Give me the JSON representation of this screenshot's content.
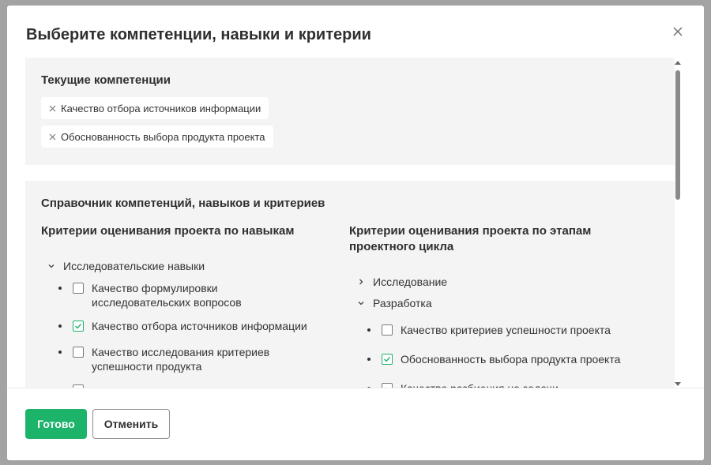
{
  "modal": {
    "title": "Выберите компетенции, навыки и критерии"
  },
  "current": {
    "heading": "Текущие компетенции",
    "chips": [
      "Качество отбора источников информации",
      "Обоснованность выбора продукта проекта"
    ]
  },
  "catalog": {
    "heading": "Справочник компетенций, навыков и критериев",
    "left_column": {
      "heading": "Критерии оценивания проекта по навыкам",
      "group": {
        "label": "Исследовательские навыки",
        "expanded": true
      },
      "items": [
        {
          "label": "Качество формулировки исследовательских вопросов",
          "checked": false
        },
        {
          "label": "Качество отбора источников информации",
          "checked": true
        },
        {
          "label": "Качество исследования критериев успешности продукта",
          "checked": false
        }
      ]
    },
    "right_column": {
      "heading": "Критерии оценивания проекта по этапам проектного цикла",
      "groups": [
        {
          "label": "Исследование",
          "expanded": false
        },
        {
          "label": "Разработка",
          "expanded": true
        }
      ],
      "items": [
        {
          "label": "Качество критериев успешности проекта",
          "checked": false
        },
        {
          "label": "Обоснованность выбора продукта проекта",
          "checked": true
        },
        {
          "label": "Качество разбиения на задачи",
          "checked": false
        }
      ]
    }
  },
  "footer": {
    "done_label": "Готово",
    "cancel_label": "Отменить"
  },
  "colors": {
    "accent": "#1db36a",
    "panel_bg": "#f4f4f4"
  }
}
